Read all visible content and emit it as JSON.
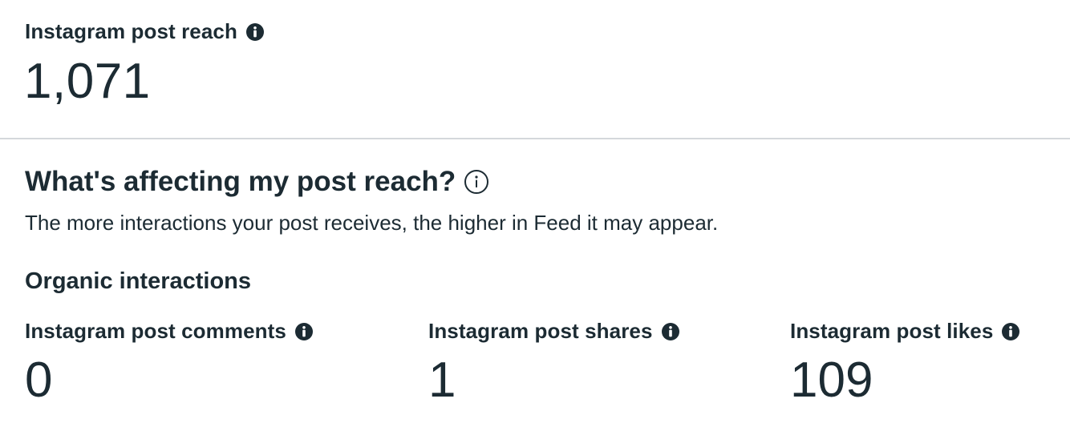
{
  "reach": {
    "label": "Instagram post reach",
    "value": "1,071",
    "info_icon": "info-solid-icon"
  },
  "affecting": {
    "heading": "What's affecting my post reach?",
    "info_icon": "info-outline-icon",
    "description": "The more interactions your post receives, the higher in Feed it may appear."
  },
  "organic": {
    "heading": "Organic interactions",
    "metrics": [
      {
        "label": "Instagram post comments",
        "value": "0",
        "info_icon": "info-solid-icon"
      },
      {
        "label": "Instagram post shares",
        "value": "1",
        "info_icon": "info-solid-icon"
      },
      {
        "label": "Instagram post likes",
        "value": "109",
        "info_icon": "info-solid-icon"
      }
    ]
  },
  "colors": {
    "text": "#1c2b33",
    "divider": "#d4d8db",
    "background": "#ffffff"
  }
}
